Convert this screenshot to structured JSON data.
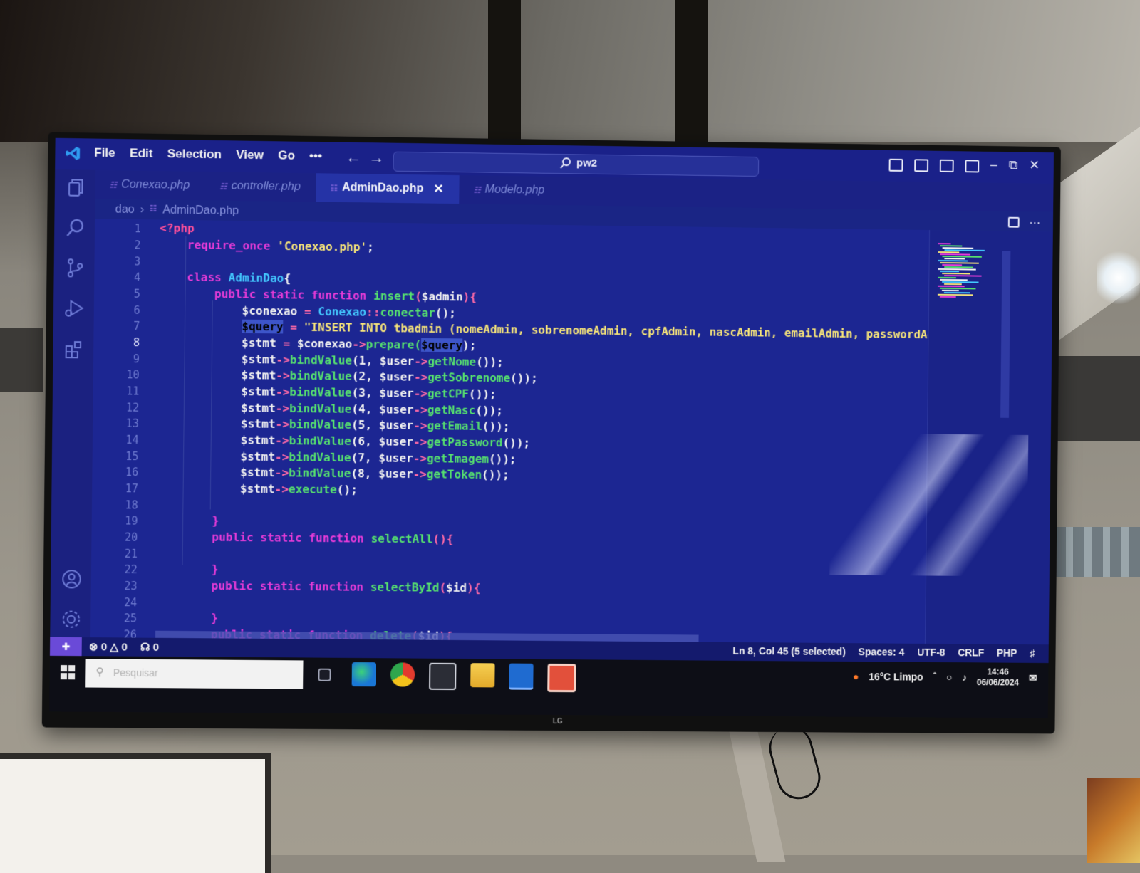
{
  "titlebar": {
    "menu": [
      "File",
      "Edit",
      "Selection",
      "View",
      "Go",
      "•••"
    ],
    "command_center": "pw2"
  },
  "tabs": [
    {
      "label": "Conexao.php",
      "active": false
    },
    {
      "label": "controller.php",
      "active": false
    },
    {
      "label": "AdminDao.php",
      "active": true
    },
    {
      "label": "Modelo.php",
      "active": false
    }
  ],
  "breadcrumb": {
    "folder": "dao",
    "file": "AdminDao.php"
  },
  "editor": {
    "line_numbers": [
      "1",
      "2",
      "3",
      "4",
      "5",
      "6",
      "7",
      "8",
      "9",
      "10",
      "11",
      "12",
      "13",
      "14",
      "15",
      "16",
      "17",
      "18",
      "19",
      "20",
      "21",
      "22",
      "23",
      "24",
      "25",
      "26"
    ],
    "current_line": "8"
  },
  "statusbar": {
    "errors": "0",
    "warnings": "0",
    "ports": "0",
    "cursor": "Ln 8, Col 45 (5 selected)",
    "spaces": "Spaces: 4",
    "encoding": "UTF-8",
    "eol": "CRLF",
    "language": "PHP"
  },
  "taskbar": {
    "search_placeholder": "Pesquisar",
    "weather": "16°C Limpo",
    "time": "14:46",
    "date": "06/06/2024"
  },
  "colors": {
    "editor_bg": "#1c2692",
    "keyword": "#e63bd8",
    "function": "#56e06f",
    "string": "#f5e37a",
    "class": "#43c8ff",
    "status_bar": "#141a6d"
  },
  "tv_brand": "LG"
}
